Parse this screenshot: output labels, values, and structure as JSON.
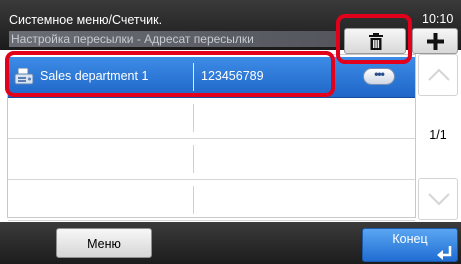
{
  "header": {
    "title": "Системное меню/Счетчик.",
    "subtitle": "Настройка пересылки - Адресат пересылки",
    "time": "10:10"
  },
  "toolbar": {
    "delete_icon": "trash-icon",
    "add_icon": "plus-icon"
  },
  "list": {
    "rows": [
      {
        "name": "Sales department 1",
        "number": "123456789",
        "selected": true,
        "icon": "fax-icon",
        "detail_label": "•••"
      },
      {
        "name": "",
        "number": "",
        "selected": false
      },
      {
        "name": "",
        "number": "",
        "selected": false
      },
      {
        "name": "",
        "number": "",
        "selected": false
      }
    ]
  },
  "pagination": {
    "page": "1/1",
    "up_icon": "chevron-up-icon",
    "down_icon": "chevron-down-icon"
  },
  "footer": {
    "menu_label": "Меню",
    "end_label": "Конец",
    "end_icon": "enter-arrow-icon"
  },
  "colors": {
    "accent": "#2b78d8",
    "highlight": "#e2001a",
    "header_bg": "#2a2a2a"
  }
}
